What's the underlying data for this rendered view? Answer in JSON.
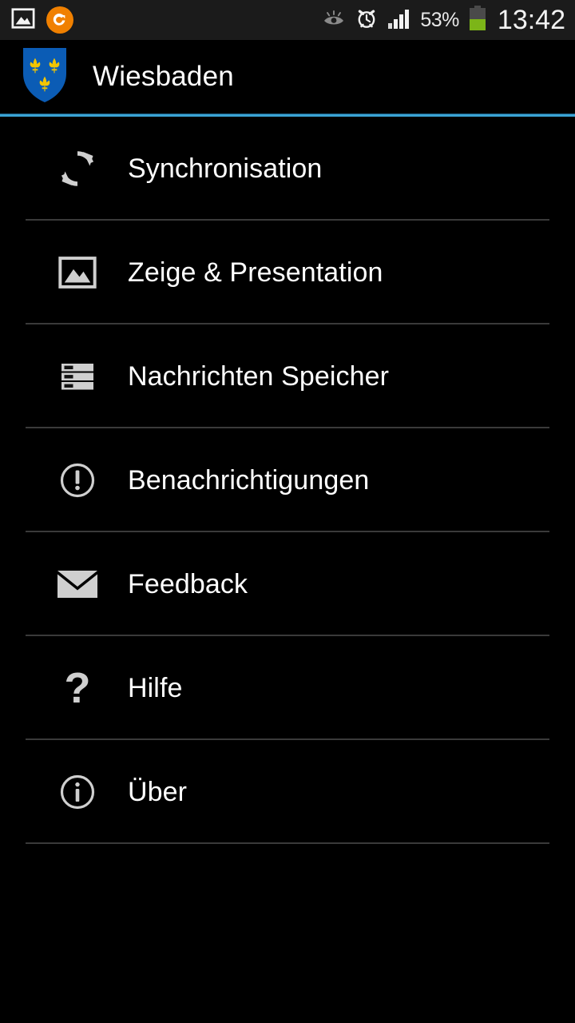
{
  "status_bar": {
    "left_icons": [
      {
        "name": "gallery-notification-icon",
        "icon": "image-frame"
      },
      {
        "name": "app-notification-icon",
        "icon": "orange-circle-swirl"
      }
    ],
    "right_icons": [
      {
        "name": "smart-stay-eye-icon",
        "icon": "eye"
      },
      {
        "name": "alarm-clock-icon",
        "icon": "alarm"
      },
      {
        "name": "signal-bars-icon",
        "icon": "signal"
      }
    ],
    "battery_percent": "53%",
    "battery_level": 53,
    "clock": "13:42",
    "colors": {
      "bar_bg": "#1b1b1b",
      "battery_fill": "#7cb518",
      "orange_badge": "#f08000"
    }
  },
  "header": {
    "title": "Wiesbaden",
    "logo_name": "wiesbaden-coat-of-arms",
    "accent_color": "#3aa3d4",
    "shield_color": "#0b5cb5",
    "fleur_color": "#f2c500"
  },
  "menu": {
    "items": [
      {
        "label": "Synchronisation",
        "icon": "sync-icon"
      },
      {
        "label": "Zeige & Presentation",
        "icon": "image-icon"
      },
      {
        "label": "Nachrichten Speicher",
        "icon": "storage-icon"
      },
      {
        "label": "Benachrichtigungen",
        "icon": "alert-circle-icon"
      },
      {
        "label": "Feedback",
        "icon": "mail-icon"
      },
      {
        "label": "Hilfe",
        "icon": "question-mark-icon"
      },
      {
        "label": "Über",
        "icon": "info-circle-icon"
      }
    ]
  }
}
